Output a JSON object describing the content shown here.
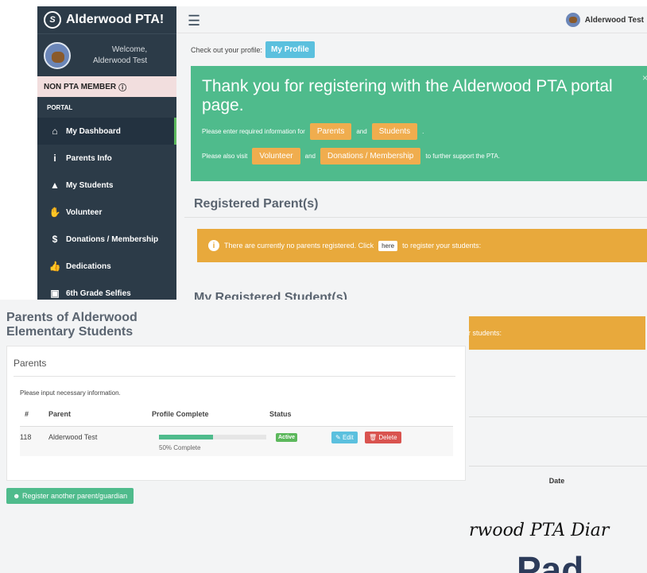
{
  "colors": {
    "sidebar": "#2c3b48",
    "accent_green": "#4fbb8c",
    "warn_orange": "#e8a93c",
    "info_blue": "#5bc0de",
    "danger_red": "#d9534f"
  },
  "back_window": {
    "brand_title": "Alderwood PTA!",
    "welcome_label": "Welcome,",
    "welcome_name": "Alderwood Test",
    "membership_status": "NON PTA MEMBER",
    "portal_heading": "PORTAL",
    "nav_items": [
      {
        "label": "My Dashboard",
        "icon": "home-icon"
      },
      {
        "label": "Parents Info",
        "icon": "info-icon"
      },
      {
        "label": "My Students",
        "icon": "graduation-cap-icon"
      },
      {
        "label": "Volunteer",
        "icon": "hand-icon"
      },
      {
        "label": "Donations / Membership",
        "icon": "dollar-icon"
      },
      {
        "label": "Dedications",
        "icon": "thumbs-up-icon"
      },
      {
        "label": "6th Grade Selfies",
        "icon": "camera-icon"
      }
    ],
    "top_user_name": "Alderwood Test",
    "profile_prompt": "Check out your profile:",
    "profile_button": "My Profile",
    "banner_title": "Thank you for registering with the Alderwood PTA portal page.",
    "banner_line1_prefix": "Please enter required information for",
    "banner_chip_parents": "Parents",
    "banner_and": "and",
    "banner_chip_students": "Students",
    "banner_period": ".",
    "banner_line2_prefix": "Please also visit",
    "banner_chip_volunteer": "Volunteer",
    "banner_and2": "and",
    "banner_chip_donations": "Donations / Membership",
    "banner_line2_suffix": "to further support the PTA.",
    "registered_parents_title": "Registered Parent(s)",
    "no_parents_text": "There are currently no parents registered. Click",
    "here_button": "here",
    "no_parents_suffix": "to register your students:",
    "registered_students_title": "My Registered Student(s)",
    "students_warn_partial": "r students:",
    "date_header": "Date",
    "diaries_partial": "rwood PTA Diar",
    "big_partial": "Pad"
  },
  "front_window": {
    "title_line1": "Parents of Alderwood",
    "title_line2": "Elementary Students",
    "panel_heading": "Parents",
    "note": "Please input necessary information.",
    "columns": [
      "#",
      "Parent",
      "Profile Complete",
      "Status"
    ],
    "rows": [
      {
        "id": "118",
        "parent": "Alderwood Test",
        "progress": 50,
        "progress_text": "50% Complete",
        "status": "Active",
        "edit": "Edit",
        "delete": "Delete"
      }
    ],
    "register_button": "Register another parent/guardian"
  }
}
